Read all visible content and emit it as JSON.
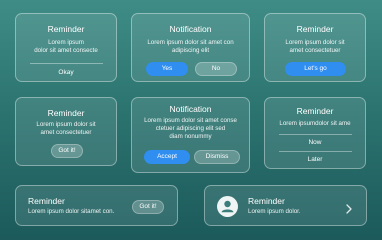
{
  "cards": {
    "c1": {
      "title": "Reminder",
      "body": [
        "Lorem ipsum",
        "dolor sit amet consecte"
      ],
      "ok": "Okay"
    },
    "c2": {
      "title": "Notification",
      "body": [
        "Lorem ipsum dolor sit amet con",
        "adipiscing elit"
      ],
      "yes": "Yes",
      "no": "No"
    },
    "c3": {
      "title": "Reminder",
      "body": [
        "Lorem ipsum dolor sit",
        "amet consectetuer"
      ],
      "go": "Let's go"
    },
    "c4": {
      "title": "Reminder",
      "body": [
        "Lorem ipsum dolor sit",
        "amet consectetuer"
      ],
      "got": "Got it!"
    },
    "c5": {
      "title": "Notification",
      "body": [
        "Lorem ipsum dolor sit amet conse",
        "ctetuer adipiscing elit sed",
        "diam nonummy"
      ],
      "accept": "Accept",
      "dismiss": "Dismiss"
    },
    "c6": {
      "title": "Reminder",
      "body": [
        "Lorem ipsumdolor sit ame"
      ],
      "now": "Now",
      "later": "Later"
    },
    "c7": {
      "title": "Reminder",
      "body": "Lorem ipsum dolor sitamet con.",
      "got": "Got it!"
    },
    "c8": {
      "title": "Reminder",
      "body": "Lorem ipsum dolor."
    }
  },
  "icons": {
    "avatar": "user-avatar-icon",
    "chevron": "chevron-right-icon"
  },
  "colors": {
    "primary": "#2f8ef0",
    "background_top": "#3f8c86",
    "background_bottom": "#1c5a5b"
  }
}
